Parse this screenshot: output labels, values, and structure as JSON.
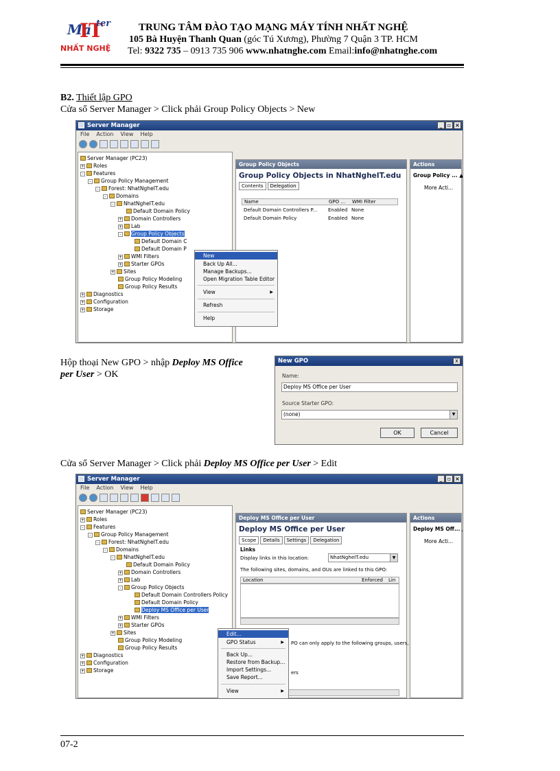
{
  "header": {
    "logo_text": "NHẤT NGHỆ",
    "logo_script": "Master IT",
    "org": "TRUNG TÂM ĐÀO TẠO MẠNG MÁY TÍNH NHẤT NGHỆ",
    "address_bold": "105 Bà Huyện Thanh Quan",
    "address_rest": " (góc Tú Xương), Phường 7 Quận 3  TP. HCM",
    "tel_label": "Tel: ",
    "tel_bold": "9322 735",
    "tel_rest": " – 0913 735 906   ",
    "website": "www.nhatnghe.com",
    "email_label": "    Email:",
    "email": "info@nhatnghe.com"
  },
  "step": {
    "label": "B2.",
    "title": "Thiết lập GPO",
    "line1": "Cửa sổ Server Manager > Click phải Group Policy Objects > New",
    "line2_pre": "Hộp thoại New GPO > nhập ",
    "line2_bold": "Deploy MS Office",
    "line2b_bold": "per User",
    "line2b_post": " > OK",
    "line3_pre": "Cửa sổ Server Manager > Click phải ",
    "line3_bold": "Deploy MS Office per User",
    "line3_post": " > Edit"
  },
  "win1": {
    "title": "Server Manager",
    "menu": [
      "File",
      "Action",
      "View",
      "Help"
    ],
    "tree": [
      "Server Manager (PC23)",
      "Roles",
      "Features",
      "Group Policy Management",
      "Forest: NhatNgheIT.edu",
      "Domains",
      "NhatNgheIT.edu",
      "Default Domain Policy",
      "Domain Controllers",
      "Lab",
      "Group Policy Objects",
      "Default Domain C",
      "Default Domain P",
      "WMI Filters",
      "Starter GPOs",
      "Sites",
      "Group Policy Modeling",
      "Group Policy Results",
      "Diagnostics",
      "Configuration",
      "Storage"
    ],
    "pane_head": "Group Policy Objects",
    "pane_title": "Group Policy Objects in NhatNgheIT.edu",
    "tabs": [
      "Contents",
      "Delegation"
    ],
    "cols": [
      "Name",
      "GPO ...",
      "WMI Filter"
    ],
    "rows": [
      [
        "Default Domain Controllers P...",
        "Enabled",
        "None"
      ],
      [
        "Default Domain Policy",
        "Enabled",
        "None"
      ]
    ],
    "actions_head": "Actions",
    "actions_sub": "Group Policy ... ▲",
    "actions_more": "More Acti...",
    "ctx": [
      "New",
      "Back Up All...",
      "Manage Backups...",
      "Open Migration Table Editor",
      "View",
      "Refresh",
      "Help"
    ]
  },
  "dialog": {
    "title": "New GPO",
    "close": "x",
    "name_label": "Name:",
    "name_value": "Deploy MS Office per User",
    "starter_label": "Source Starter GPO:",
    "starter_value": "(none)",
    "ok": "OK",
    "cancel": "Cancel"
  },
  "win2": {
    "title": "Server Manager",
    "menu": [
      "File",
      "Action",
      "View",
      "Help"
    ],
    "tree": [
      "Server Manager (PC23)",
      "Roles",
      "Features",
      "Group Policy Management",
      "Forest: NhatNgheIT.edu",
      "Domains",
      "NhatNgheIT.edu",
      "Default Domain Policy",
      "Domain Controllers",
      "Lab",
      "Group Policy Objects",
      "Default Domain Controllers Policy",
      "Default Domain Policy",
      "Deploy MS Office per User",
      "WMI Filters",
      "Starter GPOs",
      "Sites",
      "Group Policy Modeling",
      "Group Policy Results",
      "Diagnostics",
      "Configuration",
      "Storage"
    ],
    "pane_head": "Deploy MS Office per User",
    "pane_title": "Deploy MS Office per User",
    "tabs": [
      "Scope",
      "Details",
      "Settings",
      "Delegation"
    ],
    "links_label": "Links",
    "display_label": "Display links in this location:",
    "display_value": "NhatNgheIT.edu",
    "linked_text": "The following sites, domains, and OUs are linked to this GPO:",
    "cols": [
      "Location",
      "Enforced",
      "Lin"
    ],
    "filter_text": "PO can only apply to the following groups, users,",
    "filter_text2": "ers",
    "actions_head": "Actions",
    "actions_sub": "Deploy MS Off... ▲",
    "actions_more": "More Acti...",
    "ctx": [
      "Edit...",
      "GPO Status",
      "Back Up...",
      "Restore from Backup...",
      "Import Settings...",
      "Save Report...",
      "View"
    ]
  },
  "footer": {
    "page": "07-2"
  }
}
